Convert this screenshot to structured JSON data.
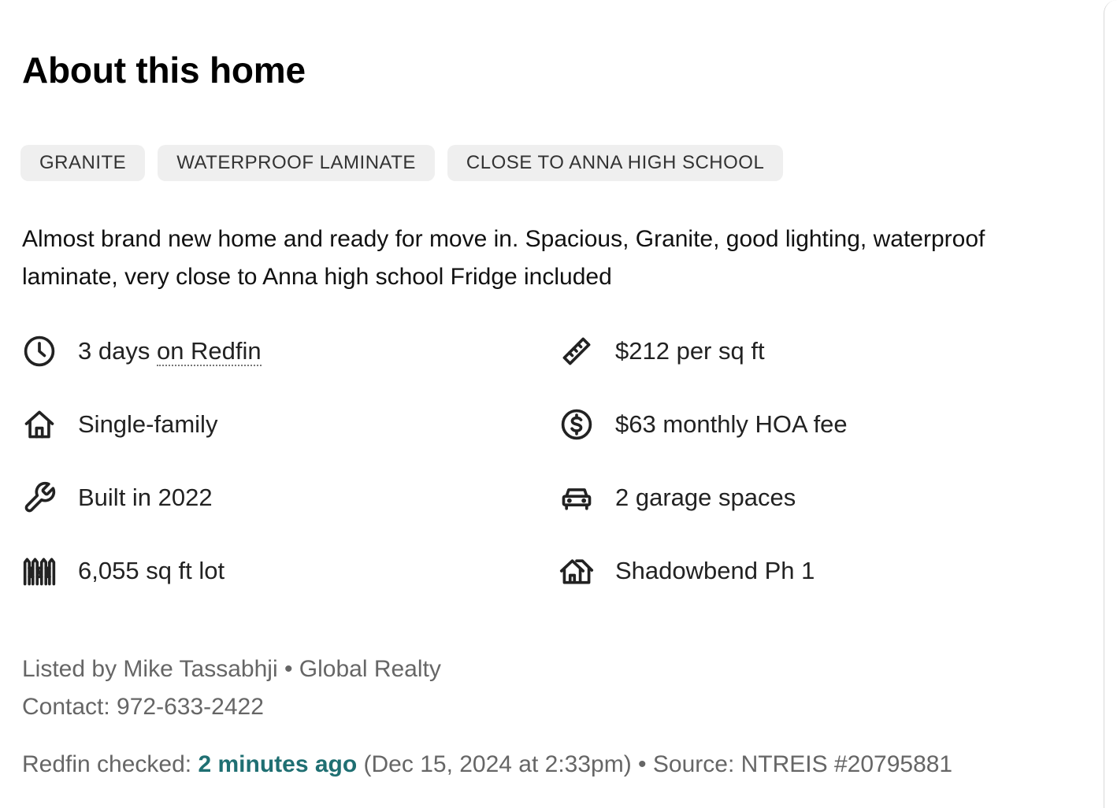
{
  "title": "About this home",
  "tags": [
    "GRANITE",
    "WATERPROOF LAMINATE",
    "CLOSE TO ANNA HIGH SCHOOL"
  ],
  "description": "Almost brand new home and ready for move in. Spacious, Granite, good lighting, waterproof laminate, very close to Anna high school Fridge included",
  "facts": {
    "days_prefix": "3 days ",
    "days_link": "on Redfin",
    "type": "Single-family",
    "built": "Built in 2022",
    "lot": "6,055 sq ft lot",
    "price_sqft": "$212 per sq ft",
    "hoa": "$63 monthly HOA fee",
    "garage": "2 garage spaces",
    "subdivision": "Shadowbend Ph 1"
  },
  "icons": {
    "days": "clock-icon",
    "type": "house-icon",
    "built": "wrench-icon",
    "lot": "fence-icon",
    "price_sqft": "ruler-icon",
    "hoa": "dollar-circle-icon",
    "garage": "car-icon",
    "subdivision": "neighborhood-icon"
  },
  "listing": {
    "listed_by": "Listed by Mike Tassabhji •  Global Realty",
    "contact": "Contact: 972-633-2422"
  },
  "checked": {
    "prefix": "Redfin checked: ",
    "link": "2 minutes ago",
    "suffix": " (Dec 15, 2024 at 2:33pm) • Source:  NTREIS #20795881"
  },
  "colors": {
    "link": "#1f6f72",
    "tag_bg": "#efefef",
    "muted_text": "#666666"
  }
}
